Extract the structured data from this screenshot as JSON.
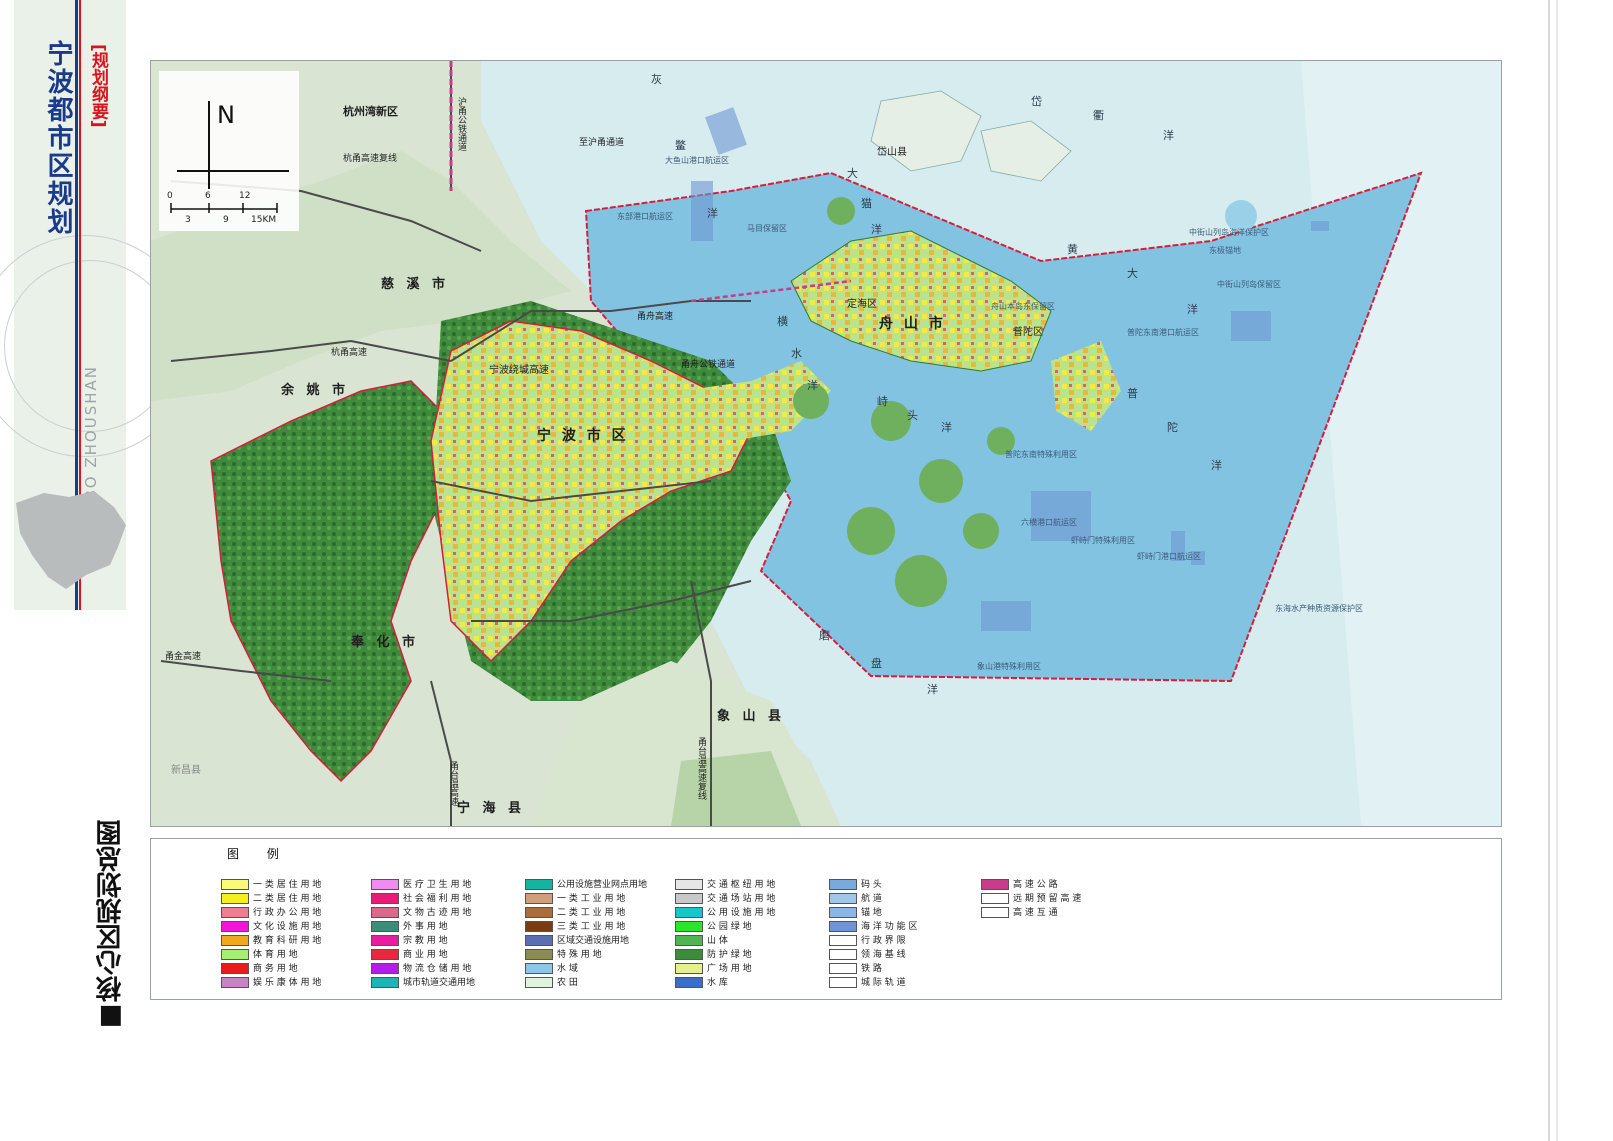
{
  "header": {
    "title": "宁波都市区规划",
    "subtitle": "[规划纲要]",
    "watermark": "NINGBO ZHOUSHAN",
    "section_title": "■核心区规划总图"
  },
  "colors": {
    "sea": "#82c3e2",
    "sea_light": "#cfe9ee",
    "land_base": "#c9dcc2",
    "forest": "#2f7a33",
    "urban": "#b9e38e",
    "boundary": "#d61e3c",
    "title_blue": "#1a3a8c",
    "subtitle_red": "#d8141c"
  },
  "map": {
    "north_label": "N",
    "scale_labels_top": [
      "0",
      "6",
      "12"
    ],
    "scale_labels_bottom": [
      "3",
      "9",
      "15KM"
    ],
    "place_labels": [
      {
        "id": "hangzhouwan",
        "text": "杭州湾新区"
      },
      {
        "id": "cixi",
        "text": "慈 溪 市"
      },
      {
        "id": "yuyao",
        "text": "余 姚 市"
      },
      {
        "id": "ningbo",
        "text": "宁 波 市 区"
      },
      {
        "id": "fenghua",
        "text": "奉 化 市"
      },
      {
        "id": "xiangshan",
        "text": "象 山 县"
      },
      {
        "id": "ninghai",
        "text": "宁 海 县"
      },
      {
        "id": "zhoushan",
        "text": "舟 山 市"
      },
      {
        "id": "daishan",
        "text": "岱山县"
      },
      {
        "id": "dinghai",
        "text": "定海区"
      },
      {
        "id": "putuo",
        "text": "普陀区"
      },
      {
        "id": "xinchang",
        "text": "新昌县"
      }
    ],
    "road_labels": [
      {
        "id": "hangyong",
        "text": "杭甬高速"
      },
      {
        "id": "hangyongfu",
        "text": "杭甬高速复线"
      },
      {
        "id": "zhihuyong",
        "text": "至沪甬通道"
      },
      {
        "id": "yongzhou",
        "text": "甬舟高速"
      },
      {
        "id": "yongzhoutie",
        "text": "甬舟公铁通道"
      },
      {
        "id": "raocheng",
        "text": "宁波绕城高速"
      },
      {
        "id": "yongjin",
        "text": "甬金高速"
      },
      {
        "id": "yongtaiwen",
        "text": "甬台温高速"
      },
      {
        "id": "yongtaiwenfu",
        "text": "甬台温高速复线"
      },
      {
        "id": "huyong",
        "text": "沪甬公铁通道"
      }
    ],
    "sea_labels": [
      {
        "id": "hui",
        "text": "灰"
      },
      {
        "id": "bie",
        "text": "鳖"
      },
      {
        "id": "yang1",
        "text": "洋"
      },
      {
        "id": "dai",
        "text": "岱"
      },
      {
        "id": "qu",
        "text": "衢"
      },
      {
        "id": "yang2",
        "text": "洋"
      },
      {
        "id": "da1",
        "text": "大"
      },
      {
        "id": "mao",
        "text": "猫"
      },
      {
        "id": "yang3",
        "text": "洋"
      },
      {
        "id": "huang",
        "text": "黄"
      },
      {
        "id": "da2",
        "text": "大"
      },
      {
        "id": "yang4",
        "text": "洋"
      },
      {
        "id": "heng",
        "text": "横"
      },
      {
        "id": "shui",
        "text": "水"
      },
      {
        "id": "yang5",
        "text": "洋"
      },
      {
        "id": "xia",
        "text": "峙"
      },
      {
        "id": "tou",
        "text": "头"
      },
      {
        "id": "yang6",
        "text": "洋"
      },
      {
        "id": "pu",
        "text": "普"
      },
      {
        "id": "tuo",
        "text": "陀"
      },
      {
        "id": "yang7",
        "text": "洋"
      },
      {
        "id": "mo",
        "text": "磨"
      },
      {
        "id": "pan",
        "text": "盘"
      },
      {
        "id": "yang8",
        "text": "洋"
      }
    ],
    "zone_labels": [
      {
        "id": "z1",
        "text": "中街山列岛海洋保护区"
      },
      {
        "id": "z2",
        "text": "中街山列岛保留区"
      },
      {
        "id": "z3",
        "text": "东极锚地"
      },
      {
        "id": "z4",
        "text": "舟山本岛东保留区"
      },
      {
        "id": "z5",
        "text": "普陀东南港口航运区"
      },
      {
        "id": "z6",
        "text": "普陀东南特殊利用区"
      },
      {
        "id": "z7",
        "text": "六横港口航运区"
      },
      {
        "id": "z8",
        "text": "虾峙门特殊利用区"
      },
      {
        "id": "z9",
        "text": "虾峙门港口航运区"
      },
      {
        "id": "z10",
        "text": "象山港特殊利用区"
      },
      {
        "id": "z11",
        "text": "东海水产种质资源保护区"
      },
      {
        "id": "z12",
        "text": "马目保留区"
      },
      {
        "id": "z13",
        "text": "东部港口航运区"
      },
      {
        "id": "z14",
        "text": "大鱼山港口航运区"
      }
    ]
  },
  "legend": {
    "title": "图  例",
    "columns": [
      [
        {
          "label": "一 类 居 住 用 地",
          "color": "#fafa7a"
        },
        {
          "label": "二 类 居 住 用 地",
          "color": "#f5f01c"
        },
        {
          "label": "行 政 办 公 用 地",
          "color": "#f07d91"
        },
        {
          "label": "文 化 设 施 用 地",
          "color": "#f015dc"
        },
        {
          "label": "教 育 科 研 用 地",
          "color": "#f0a81c"
        },
        {
          "label": "体 育 用 地",
          "color": "#a7f06f"
        },
        {
          "label": "商 务 用 地",
          "color": "#ea1a1a"
        },
        {
          "label": "娱 乐 康 体 用 地",
          "color": "#c882c8"
        }
      ],
      [
        {
          "label": "医 疗 卫 生 用 地",
          "color": "#f08cf0"
        },
        {
          "label": "社 会 福 利 用 地",
          "color": "#e81c78"
        },
        {
          "label": "文 物 古 迹 用 地",
          "color": "#d86a8c"
        },
        {
          "label": "外 事 用 地",
          "color": "#3c8c78"
        },
        {
          "label": "宗 教 用 地",
          "color": "#e81ca0"
        },
        {
          "label": "商 业 用 地",
          "color": "#e8283c"
        },
        {
          "label": "物 流 仓 储 用 地",
          "color": "#b41ce8"
        },
        {
          "label": "城市轨道交通用地",
          "color": "#1cb4b4"
        }
      ],
      [
        {
          "label": "公用设施营业网点用地",
          "color": "#14b4a0"
        },
        {
          "label": "一 类 工 业 用 地",
          "color": "#d2a078"
        },
        {
          "label": "二 类 工 业 用 地",
          "color": "#aa6e3c"
        },
        {
          "label": "三 类 工 业 用 地",
          "color": "#783c14"
        },
        {
          "label": "区域交通设施用地",
          "color": "#5a6eb4"
        },
        {
          "label": "特 殊 用 地",
          "color": "#8c8c50"
        },
        {
          "label": "水 域",
          "color": "#8cc8e6"
        },
        {
          "label": "农 田",
          "color": "#dcf5dc"
        }
      ],
      [
        {
          "label": "交 通 枢 纽 用 地",
          "color": "#e6e6e6"
        },
        {
          "label": "交 通 场 站 用 地",
          "color": "#c8c8c8"
        },
        {
          "label": "公 用 设 施 用 地",
          "color": "#14c8c8"
        },
        {
          "label": "公 园 绿 地",
          "color": "#28e628"
        },
        {
          "label": "山 体",
          "color": "#50b450"
        },
        {
          "label": "防 护 绿 地",
          "color": "#3c8c3c"
        },
        {
          "label": "广 场 用 地",
          "color": "#e6f08c"
        },
        {
          "label": "水 库",
          "color": "#3c6ec8"
        }
      ],
      [
        {
          "label": "码 头",
          "color": "#78aadc"
        },
        {
          "label": "航 道",
          "color": "#a0c8e6"
        },
        {
          "label": "锚 地",
          "color": "#8cb4e6"
        },
        {
          "label": "海 洋 功 能 区",
          "color": "#6e96d2"
        },
        {
          "label": "行 政 界 限",
          "color": "#ffffff"
        },
        {
          "label": "领 海 基 线",
          "color": "#ffffff"
        },
        {
          "label": "铁 路",
          "color": "#ffffff"
        },
        {
          "label": "城 际 轨 道",
          "color": "#ffffff"
        }
      ],
      [
        {
          "label": "高 速 公 路",
          "color": "#c83c8c"
        },
        {
          "label": "远 期 预 留 高 速",
          "color": "#ffffff"
        },
        {
          "label": "高 速 互 通",
          "color": "#ffffff"
        }
      ]
    ]
  }
}
